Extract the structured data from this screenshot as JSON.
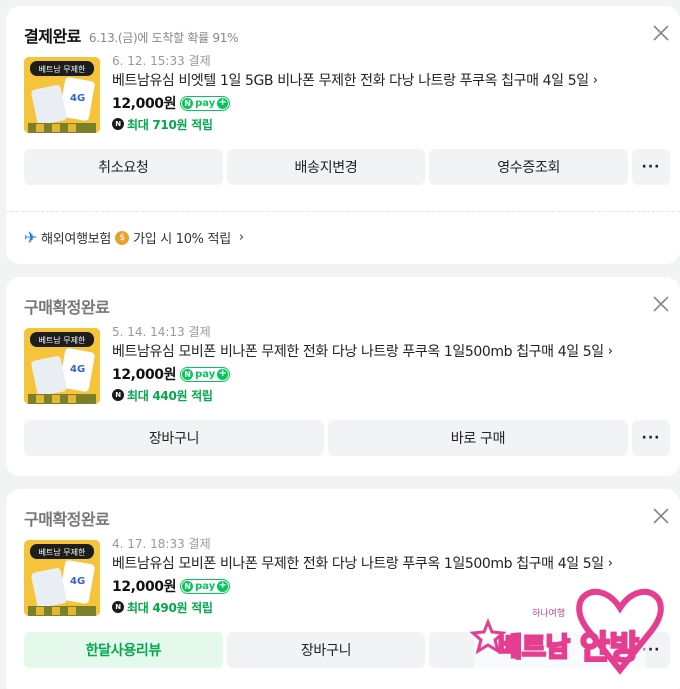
{
  "orders": [
    {
      "status": "결제완료",
      "eta": "6.13.(금)에 도착할 확률 91%",
      "date": "6. 12. 15:33 결제",
      "title": "베트남유심 비엣텔 1일 5GB 비나폰 무제한 전화 다낭 나트랑 푸쿠옥 칩구매 4일 5일",
      "price": "12,000원",
      "npay": "pay",
      "points": "최대 710원 적립",
      "thumb_label": "베트남 무제한",
      "buttons": [
        "취소요청",
        "배송지변경",
        "영수증조회"
      ],
      "more": "···",
      "promo": {
        "text_a": "해외여행보험",
        "text_b": "가입 시 10% 적립"
      }
    },
    {
      "status": "구매확정완료",
      "date": "5. 14. 14:13 결제",
      "title": "베트남유심 모비폰 비나폰 무제한 전화 다낭 나트랑 푸쿠옥 1일500mb 칩구매 4일 5일",
      "price": "12,000원",
      "npay": "pay",
      "points": "최대 440원 적립",
      "thumb_label": "베트남 무제한",
      "buttons": [
        "장바구니",
        "바로 구매"
      ],
      "more": "···"
    },
    {
      "status": "구매확정완료",
      "date": "4. 17. 18:33 결제",
      "title": "베트남유심 모비폰 비나폰 무제한 전화 다낭 나트랑 푸쿠옥 1일500mb 칩구매 4일 5일",
      "price": "12,000원",
      "npay": "pay",
      "points": "최대 490원 적립",
      "thumb_label": "베트남 무제한",
      "buttons": [
        "한달사용리뷰",
        "장바구니"
      ],
      "more": "···"
    }
  ],
  "watermark": {
    "line1": "베트남",
    "line2": "안방",
    "sub": "하나여행"
  },
  "colors": {
    "accent_green": "#03c75a",
    "points_green": "#03a84d",
    "button_bg": "#f2f3f5",
    "page_bg": "#f2f3f5"
  }
}
